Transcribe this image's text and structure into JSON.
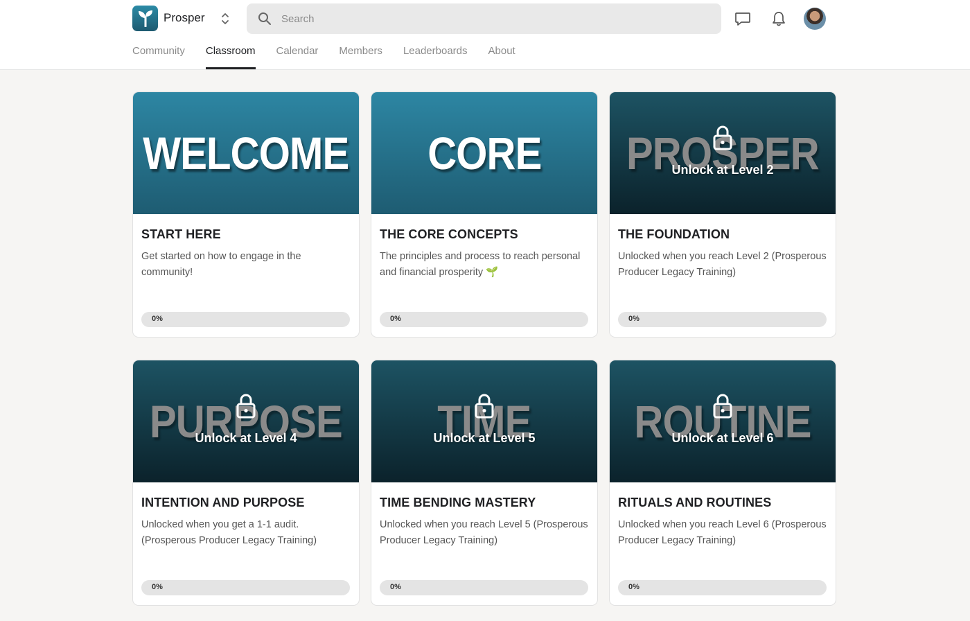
{
  "app": {
    "name": "Prosper",
    "logo_icon": "sprout-icon",
    "colors": {
      "accent": "#2c8ba6",
      "cover_unlocked": "#2d86a3",
      "cover_locked": "#0b222b"
    }
  },
  "search": {
    "placeholder": "Search",
    "value": ""
  },
  "header_icons": [
    "chat-icon",
    "bell-icon",
    "avatar"
  ],
  "tabs": [
    {
      "label": "Community",
      "active": false
    },
    {
      "label": "Classroom",
      "active": true
    },
    {
      "label": "Calendar",
      "active": false
    },
    {
      "label": "Members",
      "active": false
    },
    {
      "label": "Leaderboards",
      "active": false
    },
    {
      "label": "About",
      "active": false
    }
  ],
  "courses": [
    {
      "cover_word": "WELCOME",
      "locked": false,
      "unlock_text": "",
      "title": "START HERE",
      "description": "Get started on how to engage in the community!",
      "progress": 0,
      "progress_label": "0%"
    },
    {
      "cover_word": "CORE",
      "locked": false,
      "unlock_text": "",
      "title": "THE CORE CONCEPTS",
      "description": "The principles and process to reach personal and financial prosperity 🌱",
      "progress": 0,
      "progress_label": "0%"
    },
    {
      "cover_word": "PROSPER",
      "locked": true,
      "unlock_text": "Unlock at Level 2",
      "title": "THE FOUNDATION",
      "description": "Unlocked when you reach Level 2 (Prosperous Producer Legacy Training)",
      "progress": 0,
      "progress_label": "0%"
    },
    {
      "cover_word": "PURPOSE",
      "locked": true,
      "unlock_text": "Unlock at Level 4",
      "title": "INTENTION AND PURPOSE",
      "description": "Unlocked when you get a 1-1 audit. (Prosperous Producer Legacy Training)",
      "progress": 0,
      "progress_label": "0%"
    },
    {
      "cover_word": "TIME",
      "locked": true,
      "unlock_text": "Unlock at Level 5",
      "title": "TIME BENDING MASTERY",
      "description": "Unlocked when you reach Level 5 (Prosperous Producer Legacy Training)",
      "progress": 0,
      "progress_label": "0%"
    },
    {
      "cover_word": "ROUTINE",
      "locked": true,
      "unlock_text": "Unlock at Level 6",
      "title": "RITUALS AND ROUTINES",
      "description": "Unlocked when you reach Level 6 (Prosperous Producer Legacy Training)",
      "progress": 0,
      "progress_label": "0%"
    }
  ]
}
